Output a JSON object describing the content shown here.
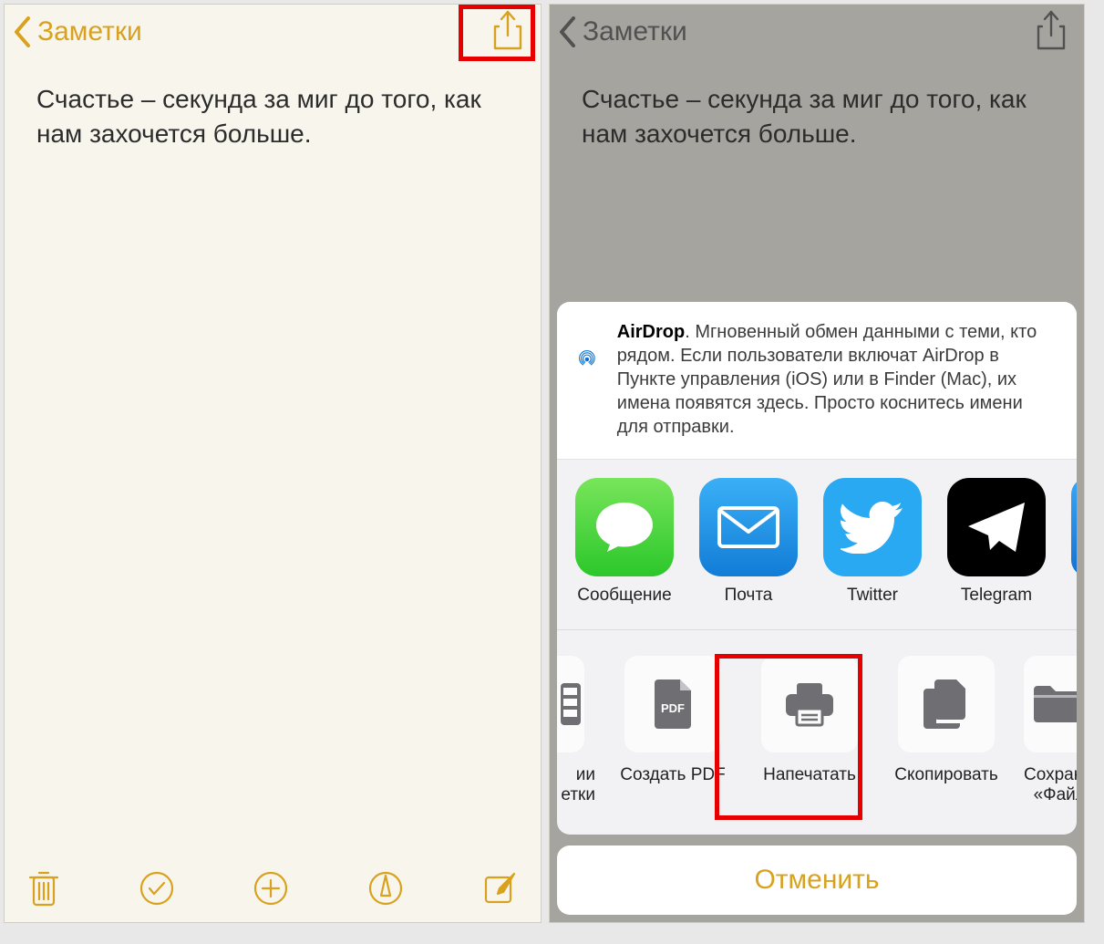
{
  "colors": {
    "accent": "#d8a21e",
    "highlight": "#e60000"
  },
  "left": {
    "back_label": "Заметки",
    "note_text": "Счастье – секунда за миг до того, как нам захочется больше."
  },
  "right": {
    "back_label": "Заметки",
    "note_text": "Счастье – секунда за миг до того, как нам захочется больше.",
    "airdrop_title": "AirDrop",
    "airdrop_description": ". Мгновенный обмен данными с теми, кто рядом. Если пользователи включат AirDrop в Пункте управления (iOS) или в Finder (Mac), их имена появятся здесь. Просто коснитесь имени для отправки.",
    "apps": [
      {
        "label": "Сообщение",
        "icon": "messages"
      },
      {
        "label": "Почта",
        "icon": "mail"
      },
      {
        "label": "Twitter",
        "icon": "twitter"
      },
      {
        "label": "Telegram",
        "icon": "telegram"
      }
    ],
    "actions_partial_left": {
      "label_line1": "ии",
      "label_line2": "етки"
    },
    "actions": [
      {
        "label": "Создать PDF",
        "icon": "pdf"
      },
      {
        "label": "Напечатать",
        "icon": "print"
      },
      {
        "label": "Скопировать",
        "icon": "copy"
      }
    ],
    "actions_partial_right": {
      "label_line1": "Сохранить",
      "label_line2": "«Файлы»"
    },
    "cancel_label": "Отменить"
  }
}
